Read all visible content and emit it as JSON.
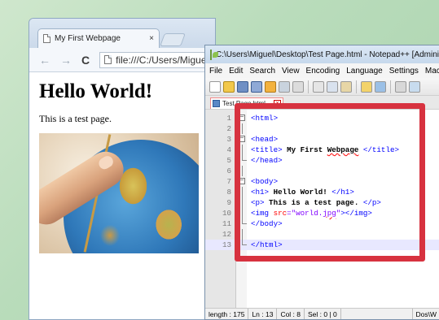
{
  "browser": {
    "tab_title": "My First Webpage",
    "tab_close": "×",
    "address": "file:///C:/Users/Miguel",
    "back_icon": "←",
    "forward_icon": "→",
    "reload_icon": "C",
    "page": {
      "heading": "Hello World!",
      "paragraph": "This is a test page."
    }
  },
  "npp": {
    "title": "C:\\Users\\Miguel\\Desktop\\Test Page.html - Notepad++ [Administr",
    "menu": [
      "File",
      "Edit",
      "Search",
      "View",
      "Encoding",
      "Language",
      "Settings",
      "Macr"
    ],
    "file_tab": "Test Page.html",
    "line_numbers": [
      "1",
      "2",
      "3",
      "4",
      "5",
      "6",
      "7",
      "8",
      "9",
      "10",
      "11",
      "12",
      "13"
    ],
    "code": {
      "l1": "<html>",
      "l3": "<head>",
      "l4_open": "<title>",
      "l4_text": " My First ",
      "l4_squiggle": "Webpage",
      "l4_close": " </title>",
      "l5": "</head>",
      "l7": "<body>",
      "l8_open": "<h1>",
      "l8_text": " Hello World! ",
      "l8_close": "</h1>",
      "l9_open": "<p>",
      "l9_text": " This is a test page. ",
      "l9_close": "</p>",
      "l10_open": "<img ",
      "l10_attr": "src",
      "l10_eq": "=\"world.",
      "l10_squiggle": "jpg",
      "l10_str_end": "\"",
      "l10_close": "></img>",
      "l11": "</body>",
      "l13": "</html>"
    },
    "status": {
      "length": "length : 175",
      "ln": "Ln : 13",
      "col": "Col : 8",
      "sel": "Sel : 0 | 0",
      "eol": "Dos\\W"
    }
  },
  "colors": {
    "highlight_box": "#d7323f",
    "tag": "#0000ff",
    "attribute": "#ff0000",
    "string": "#8000ff"
  }
}
